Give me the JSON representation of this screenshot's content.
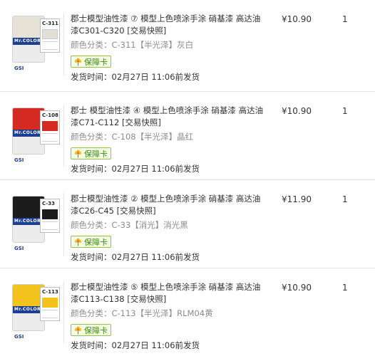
{
  "colors": {
    "badge_border": "#97c43d",
    "badge_text": "#3d8b12",
    "spec_text": "#8c8c8c"
  },
  "badge_label": "保障卡",
  "ship_text": "发货时间：02月27日 11:06前发货",
  "items": [
    {
      "title": "郡士模型油性漆 ⑦ 模型上色喷涂手涂 硝基漆 高达油漆C301-C320 [交易快照]",
      "spec": "颜色分类：C-311【半光泽】灰白",
      "price": "¥10.90",
      "qty": "1",
      "thumb": {
        "code": "C-311",
        "cap_color": "#e6e3d6",
        "swatch_color": "#e2e0d4",
        "icon": "paint-jar-icon"
      }
    },
    {
      "title": "郡士 模型油性漆 ④ 模型上色喷涂手涂 硝基漆 高达油漆C71-C112 [交易快照]",
      "spec": "颜色分类：C-108【半光泽】晶红",
      "price": "¥10.90",
      "qty": "1",
      "thumb": {
        "code": "C-108",
        "cap_color": "#d42a22",
        "swatch_color": "#d42a22",
        "icon": "paint-jar-icon"
      }
    },
    {
      "title": "郡士模型油性漆 ② 模型上色喷涂手涂 硝基漆 高达油漆C26-C45 [交易快照]",
      "spec": "颜色分类：C-33【消光】消光黑",
      "price": "¥11.90",
      "qty": "1",
      "thumb": {
        "code": "C-33",
        "cap_color": "#1c1c1c",
        "swatch_color": "#1c1c1c",
        "icon": "paint-jar-icon"
      }
    },
    {
      "title": "郡士模型油性漆 ⑤ 模型上色喷涂手涂 硝基漆 高达油漆C113-C138 [交易快照]",
      "spec": "颜色分类：C-113【半光泽】RLM04黄",
      "price": "¥10.90",
      "qty": "1",
      "thumb": {
        "code": "C-113",
        "cap_color": "#f2c21d",
        "swatch_color": "#f2c21d",
        "icon": "paint-jar-icon"
      }
    }
  ]
}
